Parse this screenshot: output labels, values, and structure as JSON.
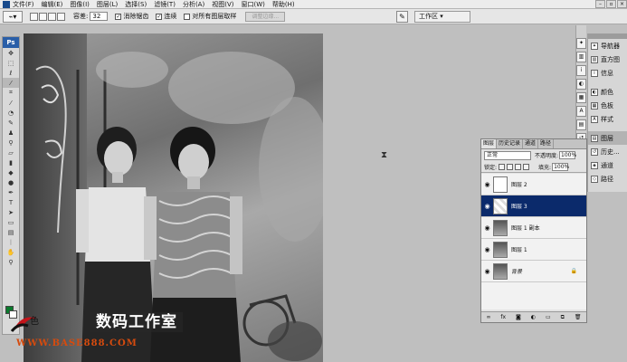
{
  "menu": [
    "文件(F)",
    "编辑(E)",
    "图像(I)",
    "图层(L)",
    "选择(S)",
    "滤镜(T)",
    "分析(A)",
    "视图(V)",
    "窗口(W)",
    "帮助(H)"
  ],
  "window_controls": [
    "–",
    "▫",
    "×"
  ],
  "options_bar": {
    "tolerance_label": "容差:",
    "tolerance_value": "32",
    "anti_alias_label": "消除锯齿",
    "contiguous_label": "连续",
    "sample_all_layers_label": "对所有图层取样",
    "refine_edge_label": "调整边缘...",
    "workspace_label": "工作区 ▾"
  },
  "toolbox": {
    "logo": "Ps",
    "tool_icons": [
      "move-icon",
      "marquee-icon",
      "lasso-icon",
      "magic-wand-icon",
      "crop-icon",
      "eyedropper-icon",
      "healing-icon",
      "brush-icon",
      "stamp-icon",
      "history-brush-icon",
      "eraser-icon",
      "gradient-icon",
      "blur-icon",
      "dodge-icon",
      "pen-icon",
      "type-icon",
      "path-select-icon",
      "shape-icon",
      "notes-icon",
      "eyedropper2-icon",
      "hand-icon",
      "zoom-icon"
    ]
  },
  "dock_panels": {
    "group1": [
      {
        "icon": "navigator-icon",
        "label": "导航器"
      },
      {
        "icon": "histogram-icon",
        "label": "直方图"
      },
      {
        "icon": "info-icon",
        "label": "信息"
      }
    ],
    "group2": [
      {
        "icon": "color-icon",
        "label": "颜色"
      },
      {
        "icon": "swatches-icon",
        "label": "色板"
      },
      {
        "icon": "styles-icon",
        "label": "样式"
      }
    ],
    "group3": [
      {
        "icon": "layers-icon",
        "label": "图层"
      },
      {
        "icon": "history-icon",
        "label": "历史..."
      },
      {
        "icon": "channels-icon",
        "label": "通道"
      },
      {
        "icon": "paths-icon",
        "label": "路径"
      }
    ]
  },
  "layers_panel": {
    "tabs": [
      "图层",
      "历史记录",
      "通道",
      "路径"
    ],
    "blend_mode": "正常",
    "opacity_label": "不透明度:",
    "opacity_value": "100%",
    "lock_label": "锁定:",
    "fill_label": "填充:",
    "fill_value": "100%",
    "layers": [
      {
        "name": "图层 2",
        "thumb": "white",
        "selected": false,
        "locked": false
      },
      {
        "name": "图层 3",
        "thumb": "checker",
        "selected": true,
        "locked": false
      },
      {
        "name": "图层 1 副本",
        "thumb": "photo",
        "selected": false,
        "locked": false
      },
      {
        "name": "图层 1",
        "thumb": "photo",
        "selected": false,
        "locked": false
      },
      {
        "name": "背景",
        "thumb": "photo",
        "selected": false,
        "locked": true
      }
    ],
    "footer_icons": [
      "link-icon",
      "fx-icon",
      "mask-icon",
      "adjustment-icon",
      "group-icon",
      "new-layer-icon",
      "trash-icon"
    ]
  },
  "watermark": {
    "logo_char": "色",
    "title": "数码工作室",
    "url": "WWW.BASE888.COM"
  },
  "colors": {
    "foreground": "#0a7a2d",
    "background": "#ffffff",
    "selection": "#0b2a6b",
    "watermark_url": "#d64b0e"
  }
}
